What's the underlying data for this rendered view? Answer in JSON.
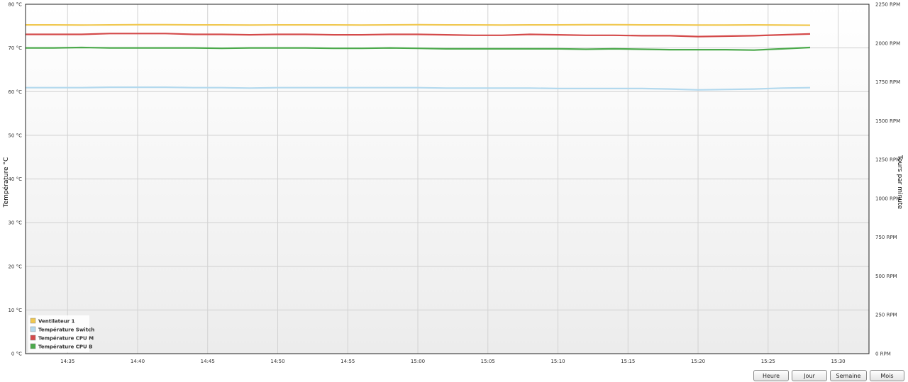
{
  "chart_data": {
    "type": "line",
    "ylabel": "Température °C",
    "y2label": "Tours par minute",
    "ylim": [
      0,
      80
    ],
    "y2lim": [
      0,
      2250
    ],
    "y_ticks": [
      "0 °C",
      "10 °C",
      "20 °C",
      "30 °C",
      "40 °C",
      "50 °C",
      "60 °C",
      "70 °C",
      "80 °C"
    ],
    "y2_ticks": [
      "0 RPM",
      "250 RPM",
      "500 RPM",
      "750 RPM",
      "1000 RPM",
      "1250 RPM",
      "1500 RPM",
      "1750 RPM",
      "2000 RPM",
      "2250 RPM"
    ],
    "x_ticks": [
      "14:35",
      "14:40",
      "14:45",
      "14:50",
      "14:55",
      "15:00",
      "15:05",
      "15:10",
      "15:15",
      "15:20",
      "15:25",
      "15:30"
    ],
    "x_tick_minutes": [
      875,
      880,
      885,
      890,
      895,
      900,
      905,
      910,
      915,
      920,
      925,
      930
    ],
    "xlim_minutes": [
      872,
      932.2
    ],
    "x": [
      872,
      874,
      876,
      878,
      880,
      882,
      884,
      886,
      888,
      890,
      892,
      894,
      896,
      898,
      900,
      902,
      904,
      906,
      908,
      910,
      912,
      914,
      916,
      918,
      920,
      922,
      924,
      926,
      928
    ],
    "grid": true,
    "legend_position": "bottom-left",
    "series": [
      {
        "name": "Ventilateur 1",
        "color": "#f0c850",
        "axis": "right",
        "values": [
          2117,
          2117,
          2116,
          2117,
          2118,
          2118,
          2117,
          2117,
          2116,
          2117,
          2117,
          2117,
          2116,
          2117,
          2118,
          2117,
          2117,
          2116,
          2117,
          2117,
          2118,
          2118,
          2117,
          2117,
          2116,
          2116,
          2117,
          2116,
          2115
        ]
      },
      {
        "name": "Température Switch",
        "color": "#b3d9ee",
        "axis": "left",
        "values": [
          60.9,
          60.9,
          60.9,
          61.0,
          61.0,
          61.0,
          60.9,
          60.9,
          60.8,
          60.9,
          60.9,
          60.9,
          60.9,
          60.9,
          60.9,
          60.8,
          60.8,
          60.8,
          60.8,
          60.7,
          60.7,
          60.7,
          60.7,
          60.6,
          60.4,
          60.5,
          60.6,
          60.8,
          60.9
        ]
      },
      {
        "name": "Température CPU M",
        "color": "#d44a4a",
        "axis": "left",
        "values": [
          73.1,
          73.1,
          73.1,
          73.3,
          73.3,
          73.3,
          73.1,
          73.1,
          73.0,
          73.1,
          73.1,
          73.0,
          73.0,
          73.1,
          73.1,
          73.0,
          72.9,
          72.9,
          73.1,
          73.0,
          72.9,
          72.9,
          72.8,
          72.8,
          72.6,
          72.7,
          72.8,
          73.0,
          73.2
        ]
      },
      {
        "name": "Température CPU B",
        "color": "#4ba94b",
        "axis": "left",
        "values": [
          70.0,
          70.0,
          70.1,
          70.0,
          70.0,
          70.0,
          70.0,
          69.9,
          70.0,
          70.0,
          70.0,
          69.9,
          69.9,
          70.0,
          69.9,
          69.8,
          69.8,
          69.8,
          69.8,
          69.8,
          69.7,
          69.8,
          69.7,
          69.6,
          69.6,
          69.6,
          69.5,
          69.8,
          70.1
        ]
      }
    ]
  },
  "buttons": {
    "hour": "Heure",
    "day": "Jour",
    "week": "Semaine",
    "month": "Mois"
  }
}
